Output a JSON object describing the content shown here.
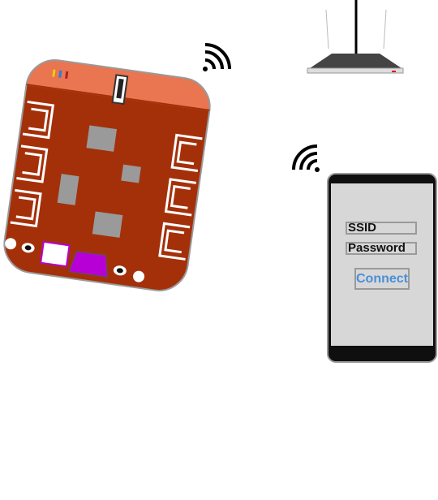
{
  "phone": {
    "ssid_label": "SSID",
    "password_label": "Password",
    "connect_label": "Connect",
    "connect_color": "#4a8fd8"
  },
  "colors": {
    "board_header": "#e97551",
    "board_body": "#a4300a",
    "connector": "#ffffff",
    "chip": "#9a9a9a",
    "usb_port": "#b700d6",
    "router_body": "#444444",
    "phone_frame": "#0f0f0f",
    "phone_screen": "#d7d7d7"
  },
  "icons": [
    "wifi-signal-icon",
    "router-icon",
    "smartphone-icon",
    "microcontroller-board-icon"
  ],
  "caption": ""
}
